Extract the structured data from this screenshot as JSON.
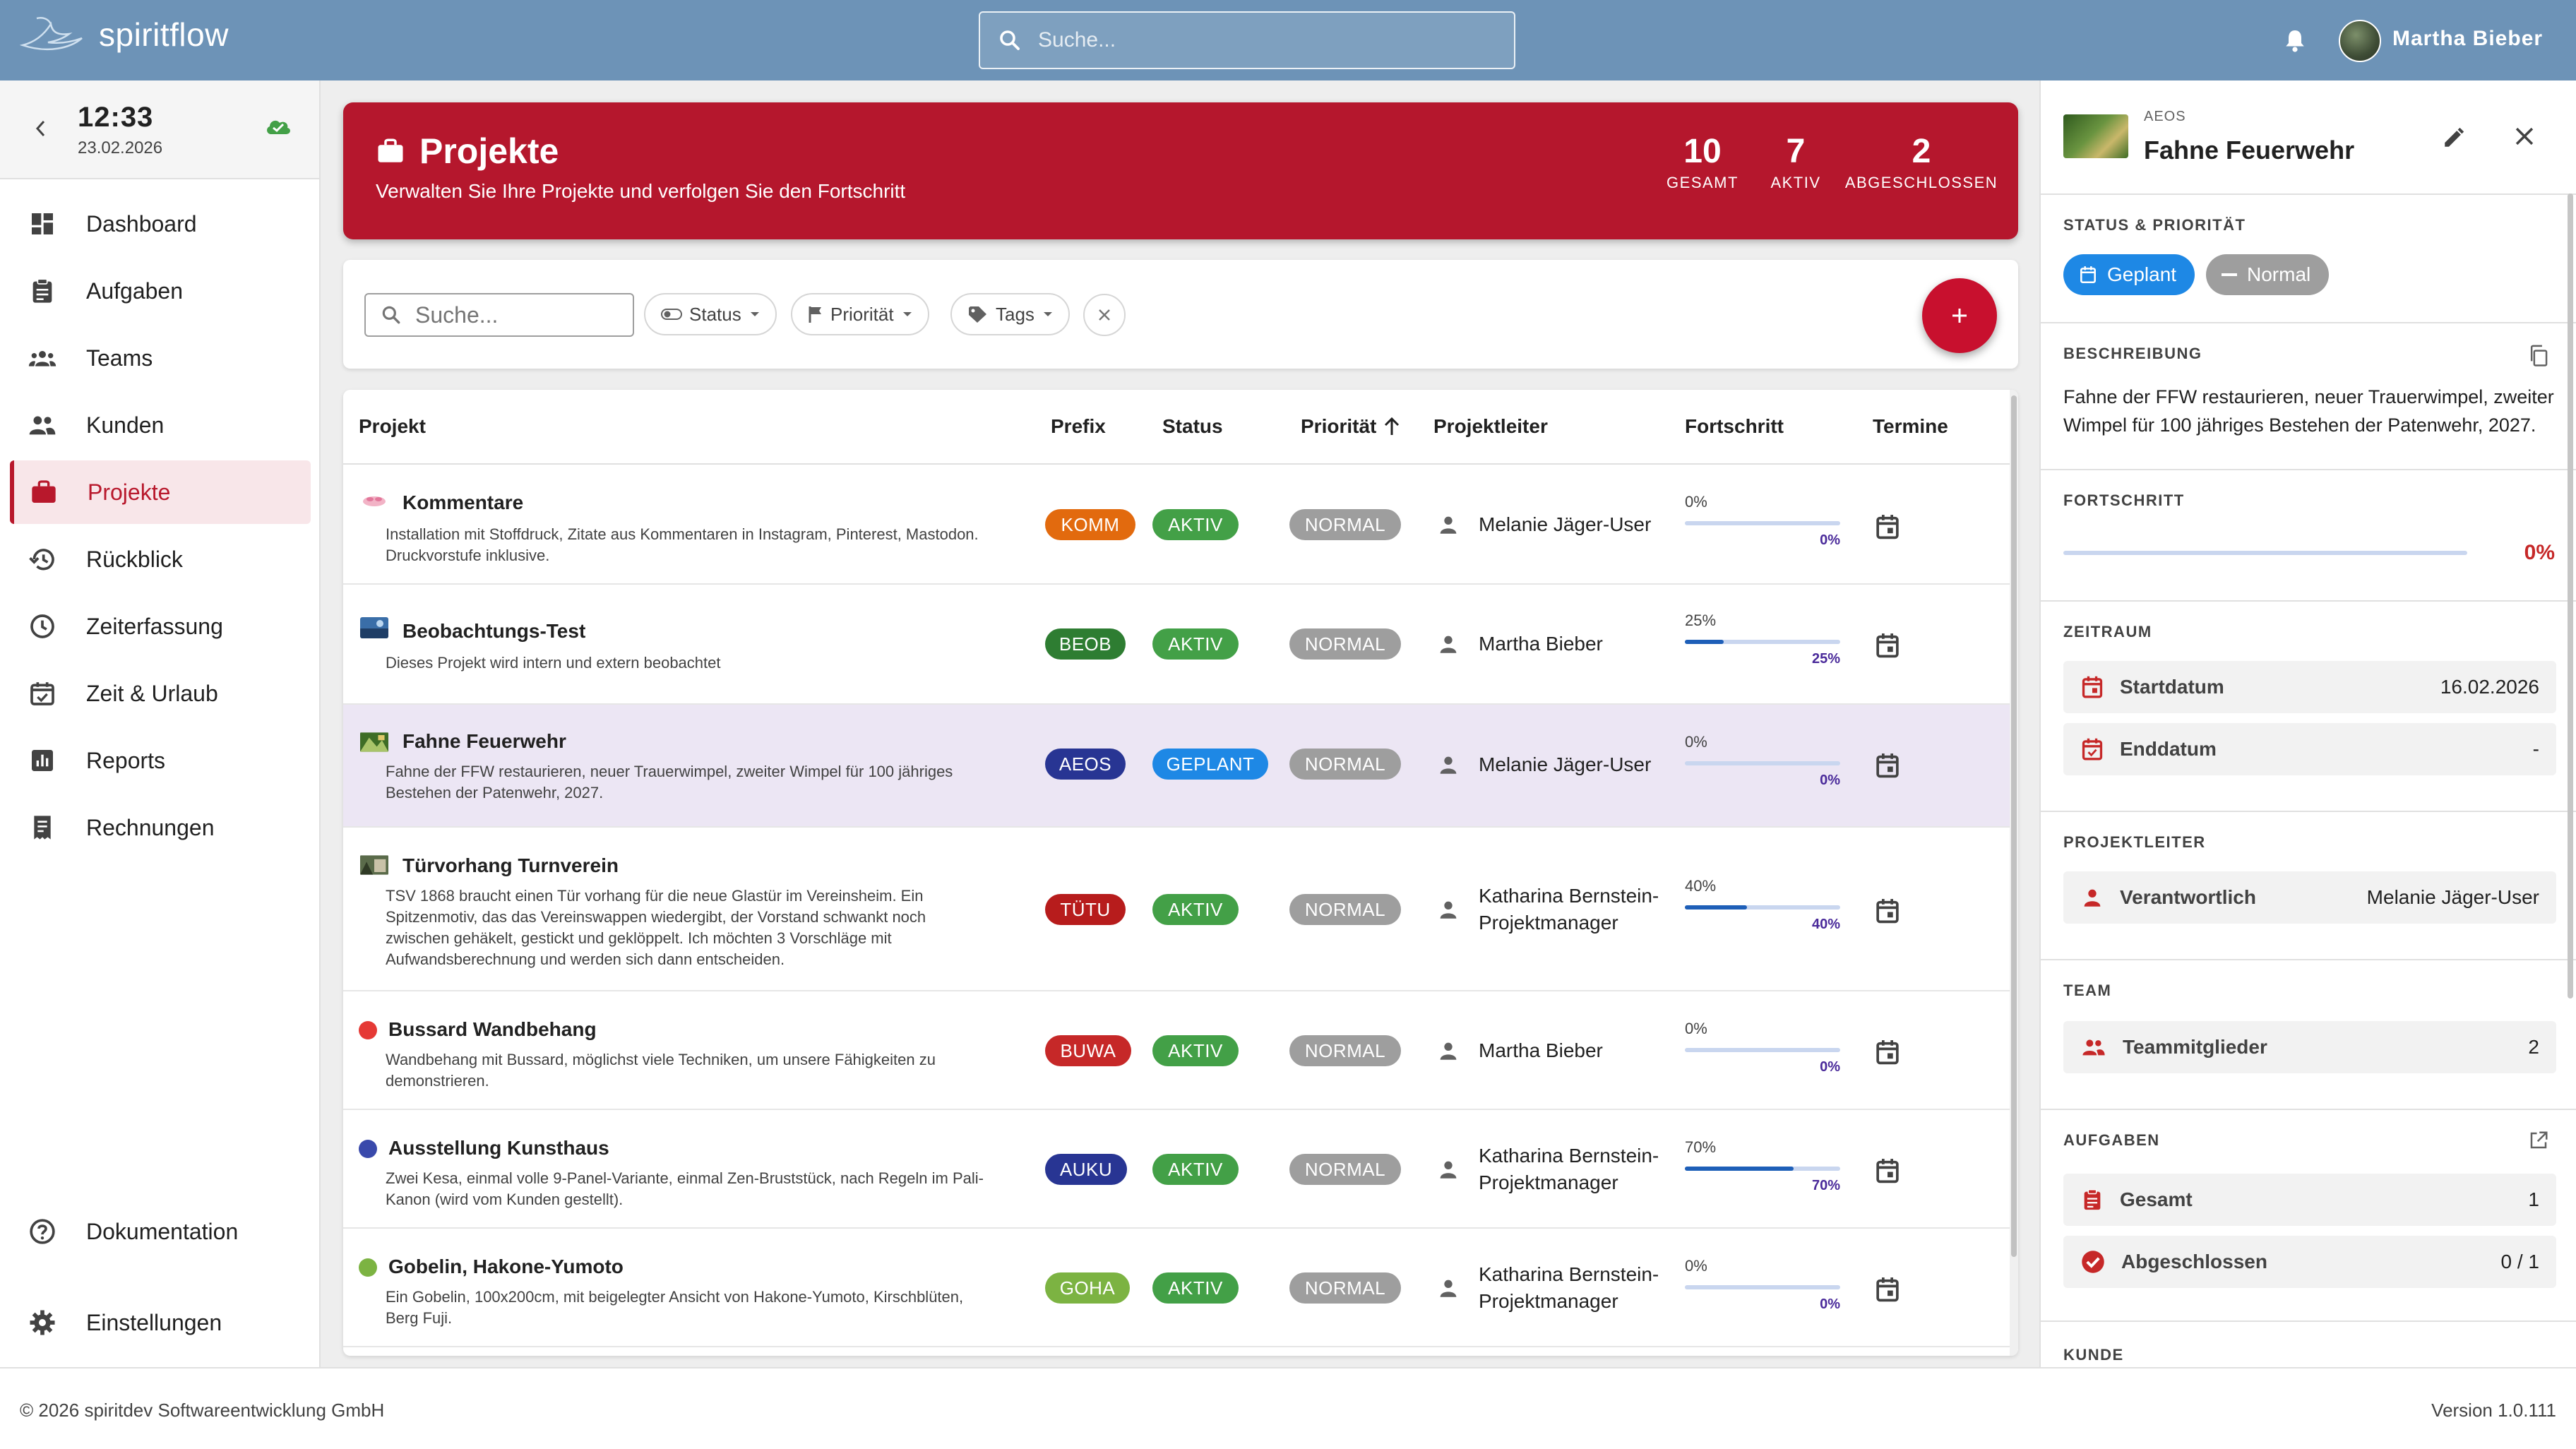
{
  "app": {
    "name": "spiritflow",
    "search_placeholder": "Suche...",
    "user_name": "Martha Bieber"
  },
  "sidebar": {
    "time": "12:33",
    "date": "23.02.2026",
    "items": [
      {
        "label": "Dashboard"
      },
      {
        "label": "Aufgaben"
      },
      {
        "label": "Teams"
      },
      {
        "label": "Kunden"
      },
      {
        "label": "Projekte"
      },
      {
        "label": "Rückblick"
      },
      {
        "label": "Zeiterfassung"
      },
      {
        "label": "Zeit & Urlaub"
      },
      {
        "label": "Reports"
      },
      {
        "label": "Rechnungen"
      }
    ],
    "bottom": [
      {
        "label": "Dokumentation"
      },
      {
        "label": "Einstellungen"
      }
    ]
  },
  "header": {
    "title": "Projekte",
    "subtitle": "Verwalten Sie Ihre Projekte und verfolgen Sie den Fortschritt",
    "stats": [
      {
        "value": "10",
        "label": "GESAMT"
      },
      {
        "value": "7",
        "label": "AKTIV"
      },
      {
        "value": "2",
        "label": "ABGESCHLOSSEN"
      }
    ]
  },
  "filters": {
    "search_placeholder": "Suche...",
    "status": "Status",
    "priority": "Priorität",
    "tags": "Tags"
  },
  "table": {
    "headers": {
      "project": "Projekt",
      "prefix": "Prefix",
      "status": "Status",
      "priority": "Priorität",
      "leader": "Projektleiter",
      "progress": "Fortschritt",
      "dates": "Termine"
    },
    "rows": [
      {
        "name": "Kommentare",
        "desc": "Installation mit Stoffdruck, Zitate aus Kommentaren in Instagram, Pinterest, Mastodon. Druckvorstufe inklusive.",
        "prefix": "KOMM",
        "prefix_color": "#e26a0e",
        "status": "AKTIV",
        "status_color": "#43a047",
        "priority": "NORMAL",
        "leader": "Melanie Jäger-User",
        "progress": 0,
        "progress_text": "0%"
      },
      {
        "name": "Beobachtungs-Test",
        "desc": "Dieses Projekt wird intern und extern beobachtet",
        "prefix": "BEOB",
        "prefix_color": "#2e7d32",
        "status": "AKTIV",
        "status_color": "#43a047",
        "priority": "NORMAL",
        "leader": "Martha Bieber",
        "progress": 25,
        "progress_text": "25%"
      },
      {
        "name": "Fahne Feuerwehr",
        "desc": "Fahne der FFW restaurieren, neuer Trauerwimpel, zweiter Wimpel für 100 jähriges Bestehen der Patenwehr, 2027.",
        "prefix": "AEOS",
        "prefix_color": "#283593",
        "status": "GEPLANT",
        "status_color": "#1e88e5",
        "priority": "NORMAL",
        "leader": "Melanie Jäger-User",
        "progress": 0,
        "progress_text": "0%"
      },
      {
        "name": "Türvorhang Turnverein",
        "desc": "TSV 1868 braucht einen Tür vorhang für die neue Glastür im Vereinsheim. Ein Spitzenmotiv, das das Vereinswappen wiedergibt, der Vorstand schwankt noch zwischen gehäkelt, gestickt und geklöppelt. Ich möchten 3 Vorschläge mit Aufwandsberechnung und werden sich dann entscheiden.",
        "prefix": "TÜTU",
        "prefix_color": "#b71c1c",
        "status": "AKTIV",
        "status_color": "#43a047",
        "priority": "NORMAL",
        "leader": "Katharina Bernstein-Projektmanager",
        "progress": 40,
        "progress_text": "40%"
      },
      {
        "name": "Bussard Wandbehang",
        "desc": "Wandbehang mit Bussard, möglichst viele Techniken, um unsere Fähigkeiten zu demonstrieren.",
        "prefix": "BUWA",
        "prefix_color": "#c62828",
        "status": "AKTIV",
        "status_color": "#43a047",
        "priority": "NORMAL",
        "leader": "Martha Bieber",
        "progress": 0,
        "progress_text": "0%"
      },
      {
        "name": "Ausstellung Kunsthaus",
        "desc": "Zwei Kesa, einmal volle 9-Panel-Variante, einmal Zen-Bruststück, nach Regeln im Pali-Kanon (wird vom Kunden gestellt).",
        "prefix": "AUKU",
        "prefix_color": "#283593",
        "status": "AKTIV",
        "status_color": "#43a047",
        "priority": "NORMAL",
        "leader": "Katharina Bernstein-Projektmanager",
        "progress": 70,
        "progress_text": "70%"
      },
      {
        "name": "Gobelin, Hakone-Yumoto",
        "desc": "Ein Gobelin, 100x200cm, mit beigelegter Ansicht von Hakone-Yumoto, Kirschblüten, Berg Fuji.",
        "prefix": "GOHA",
        "prefix_color": "#7cb342",
        "status": "AKTIV",
        "status_color": "#43a047",
        "priority": "NORMAL",
        "leader": "Katharina Bernstein-Projektmanager",
        "progress": 0,
        "progress_text": "0%"
      }
    ]
  },
  "detail": {
    "code": "AEOS",
    "title": "Fahne Feuerwehr",
    "status_section": "STATUS & PRIORITÄT",
    "status_chip": "Geplant",
    "priority_chip": "Normal",
    "desc_section": "BESCHREIBUNG",
    "description": "Fahne der FFW restaurieren, neuer Trauerwimpel, zweiter Wimpel für 100 jähriges Bestehen der Patenwehr, 2027.",
    "progress_section": "FORTSCHRITT",
    "progress_value": "0%",
    "period_section": "ZEITRAUM",
    "start_label": "Startdatum",
    "start_value": "16.02.2026",
    "end_label": "Enddatum",
    "end_value": "-",
    "leader_section": "PROJEKTLEITER",
    "leader_label": "Verantwortlich",
    "leader_value": "Melanie Jäger-User",
    "team_section": "TEAM",
    "team_label": "Teammitglieder",
    "team_value": "2",
    "tasks_section": "AUFGABEN",
    "tasks_total_label": "Gesamt",
    "tasks_total_value": "1",
    "tasks_done_label": "Abgeschlossen",
    "tasks_done_value": "0 / 1",
    "customer_section": "KUNDE"
  },
  "footer": {
    "copyright": "© 2026 spiritdev Softwareentwicklung GmbH",
    "version": "Version 1.0.111"
  },
  "colors": {
    "topbar": "#6d93b7",
    "accent": "#b5172d",
    "selected_row": "#ece6f4"
  }
}
